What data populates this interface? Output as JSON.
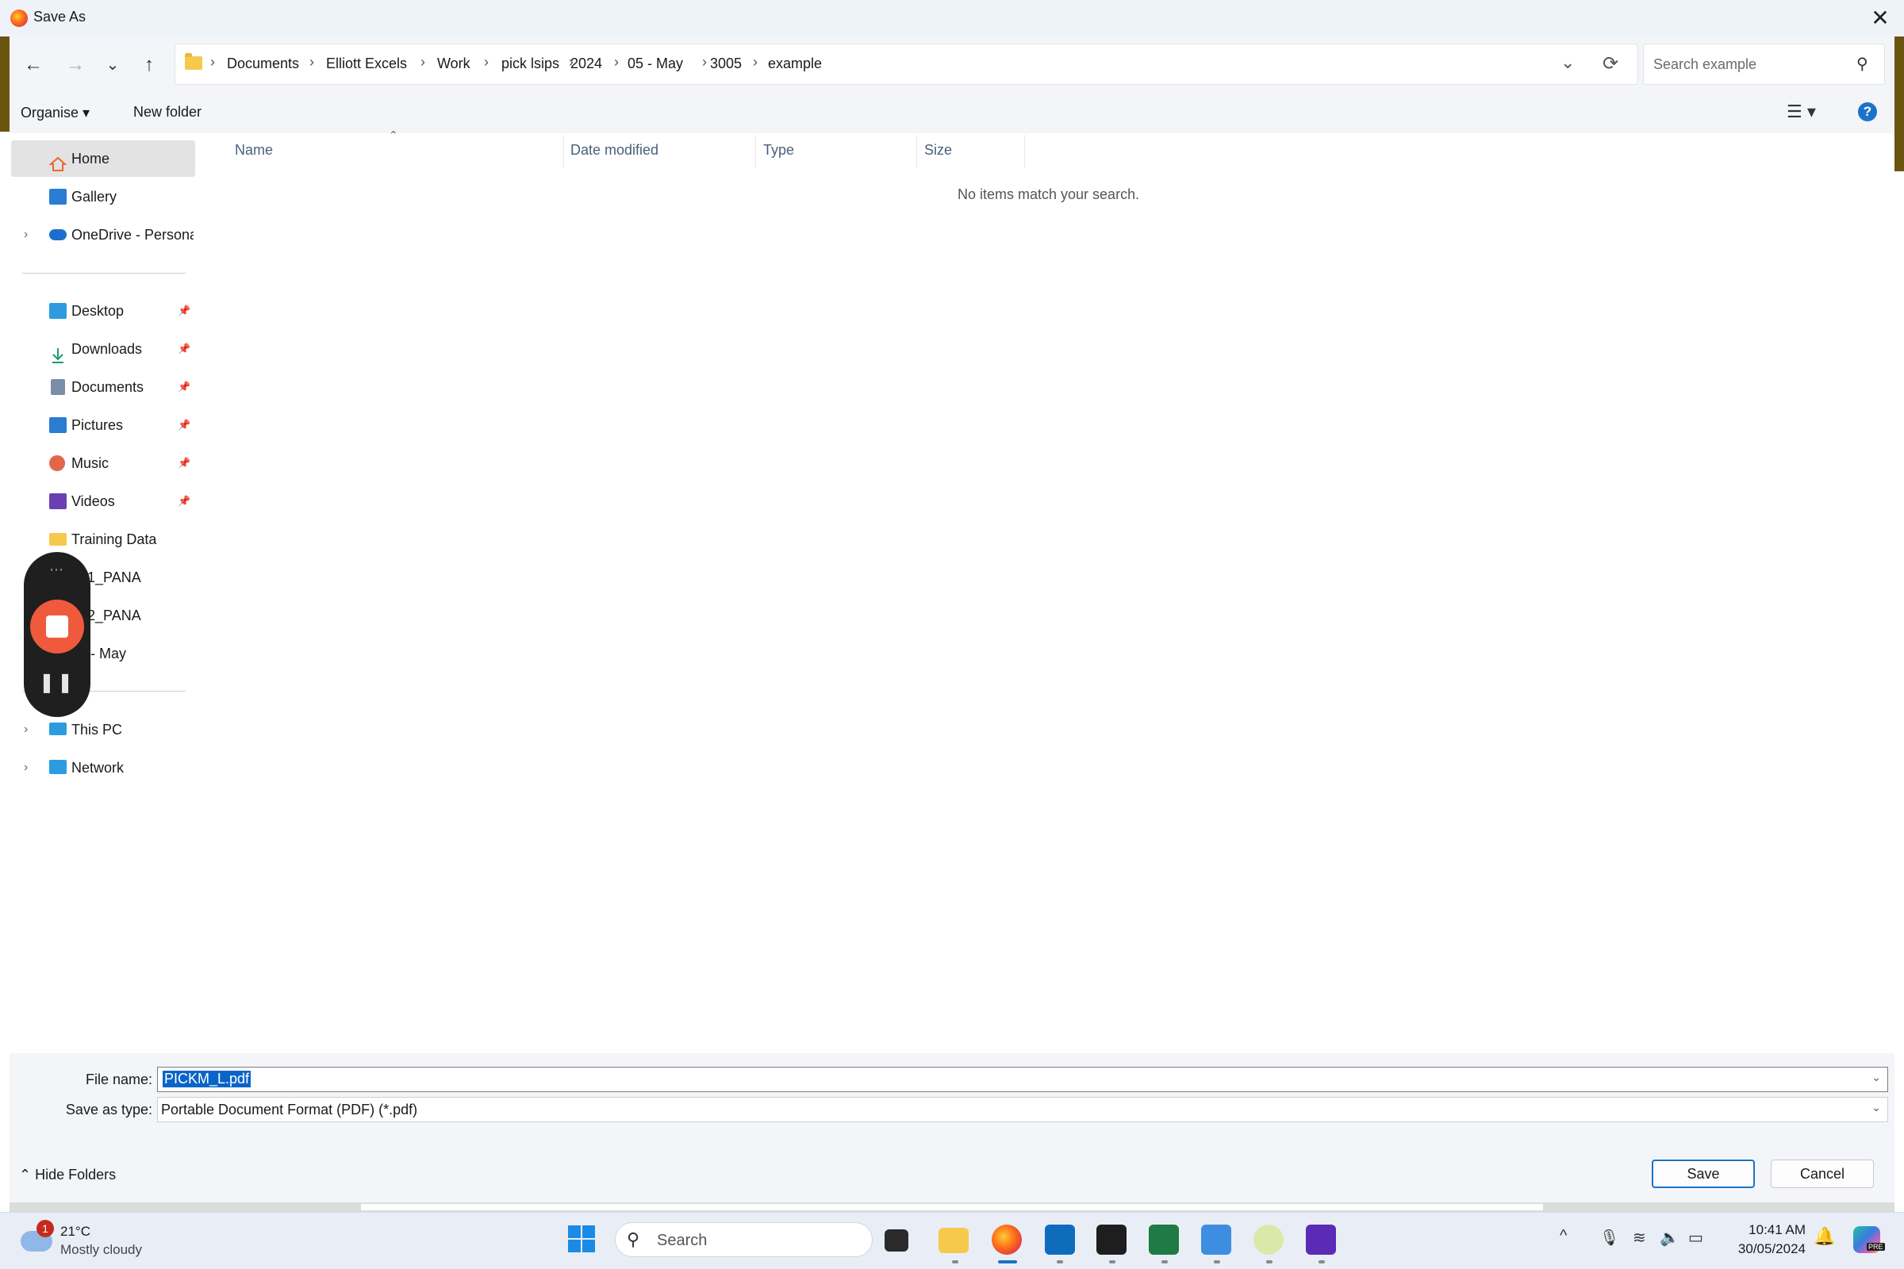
{
  "window": {
    "title": "Save As",
    "close_glyph": "✕"
  },
  "nav": {
    "back_glyph": "←",
    "forward_glyph": "→",
    "recent_glyph": "⌄",
    "up_glyph": "↑",
    "refresh_glyph": "⟳",
    "dropdown_glyph": "⌄",
    "separator_glyph": "›"
  },
  "breadcrumb": [
    "Documents",
    "Elliott Excels",
    "Work",
    "pick lsips",
    "2024",
    "05 - May",
    "3005",
    "example"
  ],
  "search": {
    "placeholder": "Search example",
    "icon_glyph": "⚲"
  },
  "toolbar": {
    "organise_label": "Organise ▾",
    "new_folder_label": "New folder",
    "view_glyph": "☰ ▾",
    "help_glyph": "?"
  },
  "sidebar": {
    "items": [
      {
        "label": "Home",
        "icon": "home-icon"
      },
      {
        "label": "Gallery",
        "icon": "gallery-icon"
      },
      {
        "label": "OneDrive - Persona",
        "icon": "onedrive-icon"
      },
      {
        "label": "Desktop",
        "icon": "desktop-icon"
      },
      {
        "label": "Downloads",
        "icon": "downloads-icon"
      },
      {
        "label": "Documents",
        "icon": "documents-icon"
      },
      {
        "label": "Pictures",
        "icon": "pictures-icon"
      },
      {
        "label": "Music",
        "icon": "music-icon"
      },
      {
        "label": "Videos",
        "icon": "videos-icon"
      },
      {
        "label": "Training Data",
        "icon": "folder-icon"
      },
      {
        "label": "1_PANA",
        "icon": "folder-icon"
      },
      {
        "label": "2_PANA",
        "icon": "folder-icon"
      },
      {
        "label": "- May",
        "icon": "folder-icon"
      },
      {
        "label": "This PC",
        "icon": "this-pc-icon"
      },
      {
        "label": "Network",
        "icon": "network-icon"
      }
    ],
    "pin_glyph": "📌",
    "expand_glyph": "›"
  },
  "recorder": {
    "dots": "⋯",
    "pause_glyph": "❚❚"
  },
  "columns": [
    "Name",
    "Date modified",
    "Type",
    "Size"
  ],
  "sort_caret": "⌃",
  "empty_message": "No items match your search.",
  "form": {
    "file_name_label": "File name:",
    "file_name_value": "PICKM_L.pdf",
    "save_type_label": "Save as type:",
    "save_type_value": "Portable Document Format (PDF) (*.pdf)",
    "dropdown_glyph": "⌄"
  },
  "footer": {
    "hide_folders_label": "⌃  Hide Folders",
    "save_label": "Save",
    "cancel_label": "Cancel"
  },
  "taskbar": {
    "weather_temp": "21°C",
    "weather_desc": "Mostly cloudy",
    "weather_badge": "1",
    "search_label": "Search",
    "search_icon_glyph": "⚲",
    "apps": [
      "task-view",
      "file-explorer",
      "firefox",
      "outlook",
      "terminal",
      "excel",
      "notepad",
      "green-app",
      "purple-app"
    ],
    "tray_chevron": "^",
    "time": "10:41 AM",
    "date": "30/05/2024",
    "bell_glyph": "🔔",
    "copilot_badge": "PRE",
    "colors": {
      "accent": "#1a73c8",
      "selection": "#0a64c8",
      "recorder_stop": "#ef5a3d"
    }
  }
}
